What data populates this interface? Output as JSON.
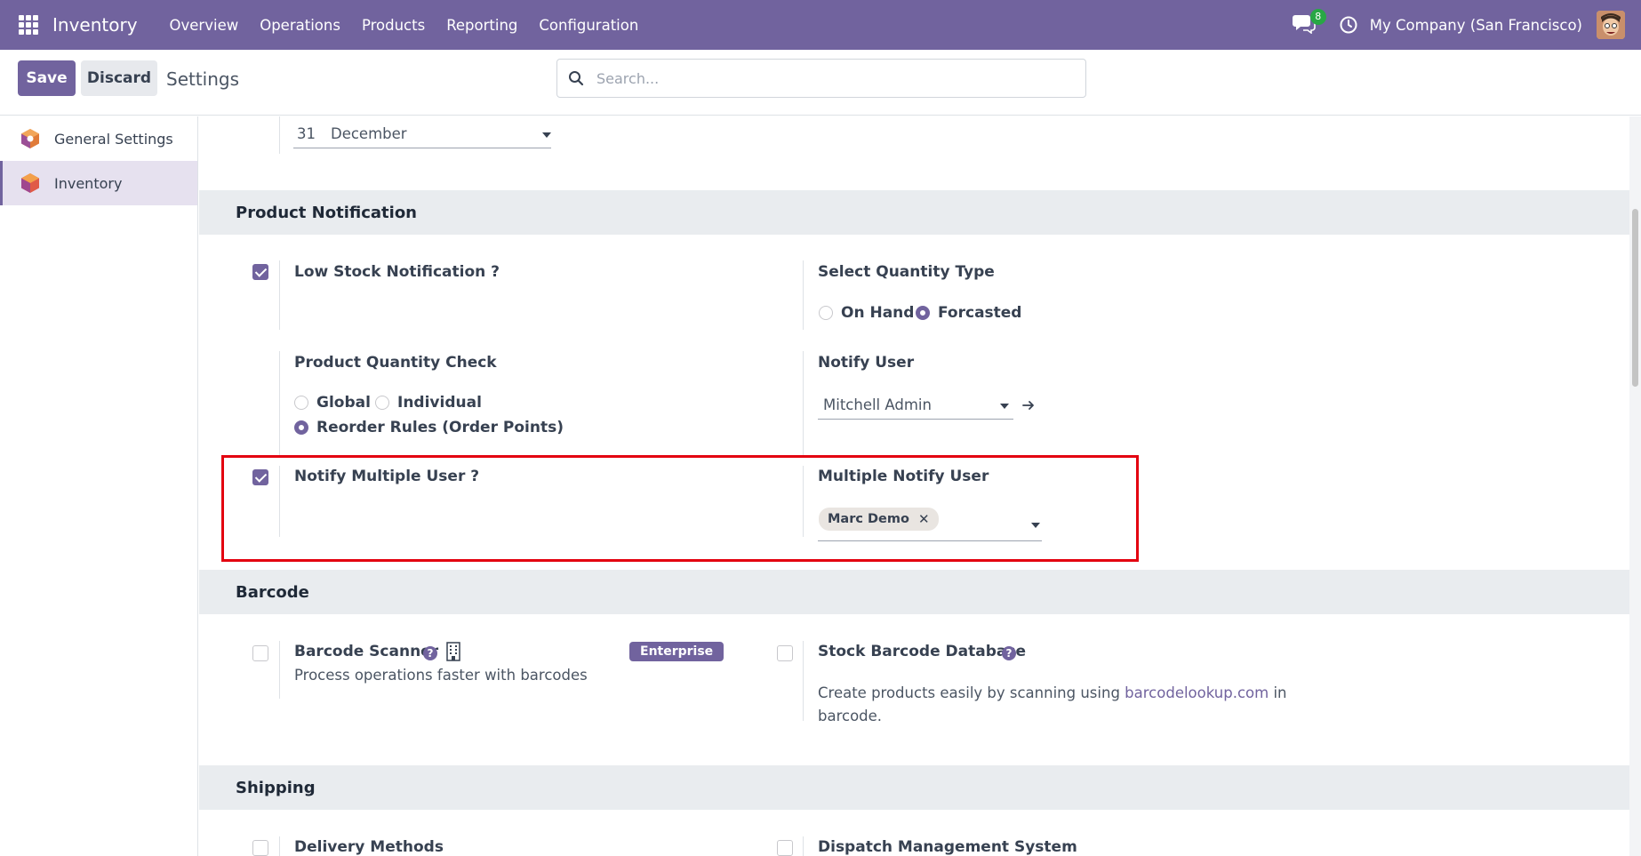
{
  "navbar": {
    "brand": "Inventory",
    "menu": [
      "Overview",
      "Operations",
      "Products",
      "Reporting",
      "Configuration"
    ],
    "message_count": "8",
    "company": "My Company (San Francisco)"
  },
  "control_panel": {
    "save_label": "Save",
    "discard_label": "Discard",
    "title": "Settings",
    "search_placeholder": "Search..."
  },
  "sidebar": {
    "items": [
      {
        "label": "General Settings",
        "active": false
      },
      {
        "label": "Inventory",
        "active": true
      }
    ]
  },
  "fiscal": {
    "day": "31",
    "month": "December"
  },
  "product_notification": {
    "title": "Product Notification",
    "low_stock_label": "Low Stock Notification ?",
    "low_stock_checked": true,
    "qty_type_label": "Select Quantity Type",
    "qty_type_options": [
      "On Hand",
      "Forcasted"
    ],
    "qty_type_selected": "Forcasted",
    "qty_check_label": "Product Quantity Check",
    "qty_check_options": [
      "Global",
      "Individual",
      "Reorder Rules (Order Points)"
    ],
    "qty_check_selected": "Reorder Rules (Order Points)",
    "notify_user_label": "Notify User",
    "notify_user_value": "Mitchell Admin",
    "notify_multiple_label": "Notify Multiple User ?",
    "notify_multiple_checked": true,
    "multiple_notify_label": "Multiple Notify User",
    "multiple_notify_tags": [
      "Marc Demo"
    ]
  },
  "barcode": {
    "title": "Barcode",
    "scanner_label": "Barcode Scanner",
    "scanner_desc": "Process operations faster with barcodes",
    "enterprise_badge": "Enterprise",
    "db_label": "Stock Barcode Database",
    "db_desc_prefix": "Create products easily by scanning using",
    "db_link": "barcodelookup.com",
    "db_desc_mid": "in",
    "db_desc_suffix": "barcode."
  },
  "shipping": {
    "title": "Shipping",
    "delivery_label": "Delivery Methods",
    "dispatch_label": "Dispatch Management System"
  },
  "colors": {
    "brand": "#71639e",
    "highlight": "#e3000f",
    "badge": "#28a745"
  }
}
